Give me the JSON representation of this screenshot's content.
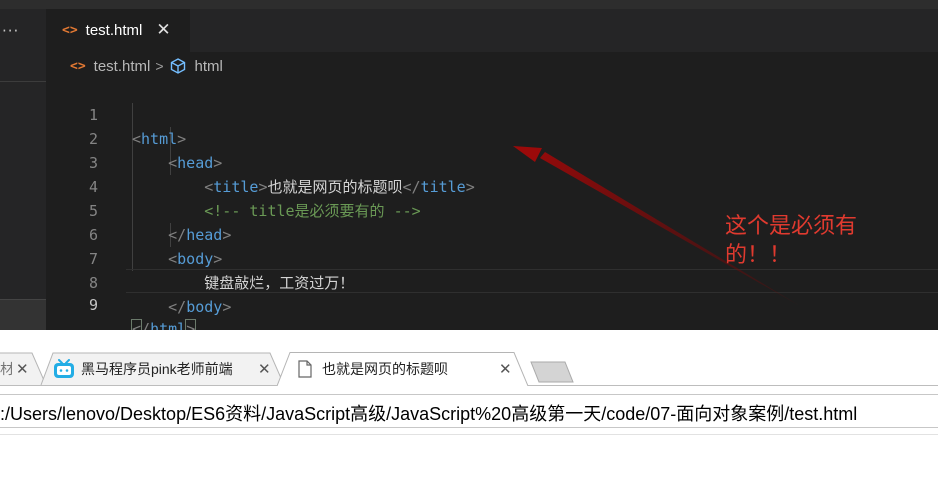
{
  "editor": {
    "sidebar_more": "···",
    "tab": {
      "label": "test.html",
      "close": "✕",
      "icon": "code-brackets-icon"
    },
    "breadcrumb": {
      "file": "test.html",
      "separator": ">",
      "symbol": "html",
      "symbol_icon": "cube-icon"
    },
    "lines": [
      {
        "number": "1"
      },
      {
        "number": "2"
      },
      {
        "number": "3",
        "title_text": "也就是网页的标题呗"
      },
      {
        "number": "4",
        "comment": "<!-- title是必须要有的 -->"
      },
      {
        "number": "5"
      },
      {
        "number": "6"
      },
      {
        "number": "7",
        "body_text": "键盘敲烂，工资过万！"
      },
      {
        "number": "8"
      },
      {
        "number": "9"
      }
    ],
    "tags": {
      "html": "html",
      "head": "head",
      "title": "title",
      "body": "body"
    },
    "colors": {
      "tag": "#569cd6",
      "bracket": "#808080",
      "comment": "#6a9955",
      "text": "#d4d4d4",
      "file_icon": "#e37933"
    }
  },
  "annotation": {
    "line1": "这个是必须有",
    "line2": "的！！",
    "color": "#e03a2f"
  },
  "browser": {
    "tabs": [
      {
        "label": "材",
        "close": "✕"
      },
      {
        "label": "黑马程序员pink老师前端",
        "close": "✕",
        "icon": "bilibili-icon"
      },
      {
        "label": "也就是网页的标题呗",
        "close": "✕",
        "icon": "page-icon",
        "active": true
      }
    ],
    "url": ":/Users/lenovo/Desktop/ES6资料/JavaScript高级/JavaScript%20高级第一天/code/07-面向对象案例/test.html"
  }
}
